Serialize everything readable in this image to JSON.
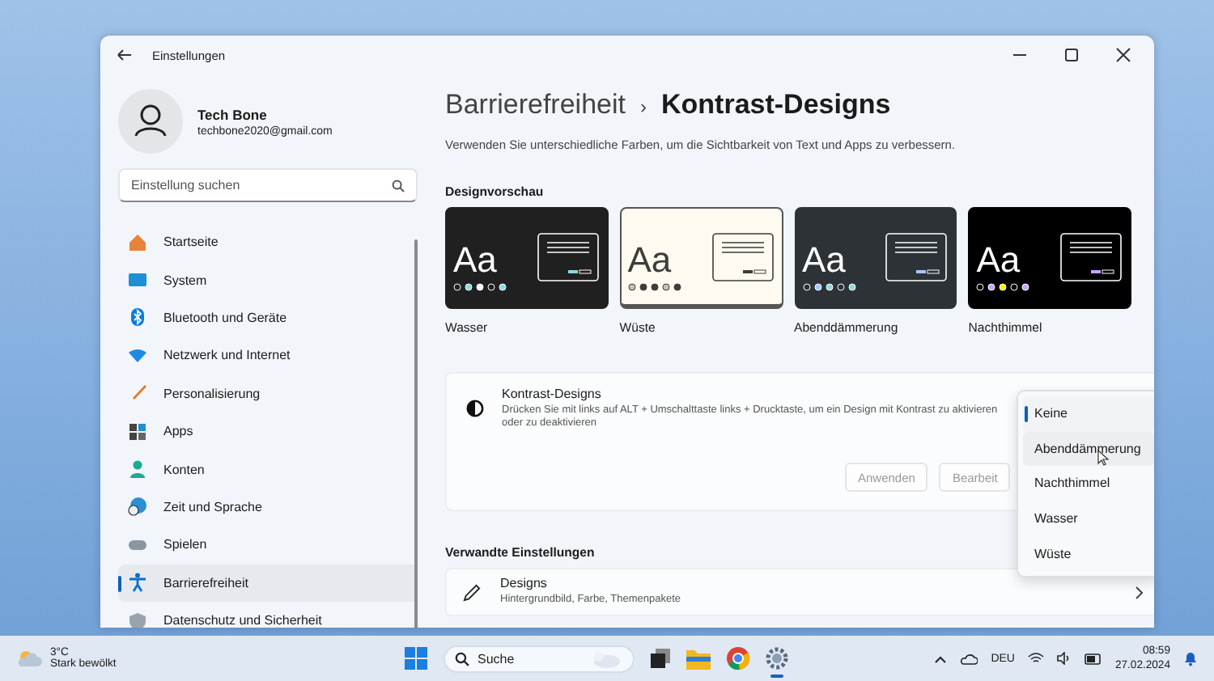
{
  "window": {
    "title": "Einstellungen"
  },
  "profile": {
    "name": "Tech Bone",
    "email": "techbone2020@gmail.com"
  },
  "search": {
    "placeholder": "Einstellung suchen"
  },
  "sidebar": {
    "items": [
      {
        "label": "Startseite",
        "selected": false
      },
      {
        "label": "System",
        "selected": false
      },
      {
        "label": "Bluetooth und Geräte",
        "selected": false
      },
      {
        "label": "Netzwerk und Internet",
        "selected": false
      },
      {
        "label": "Personalisierung",
        "selected": false
      },
      {
        "label": "Apps",
        "selected": false
      },
      {
        "label": "Konten",
        "selected": false
      },
      {
        "label": "Zeit und Sprache",
        "selected": false
      },
      {
        "label": "Spielen",
        "selected": false
      },
      {
        "label": "Barrierefreiheit",
        "selected": true
      },
      {
        "label": "Datenschutz und Sicherheit",
        "selected": false
      }
    ]
  },
  "breadcrumb": {
    "parent": "Barrierefreiheit",
    "separator": "›",
    "current": "Kontrast-Designs"
  },
  "description": "Verwenden Sie unterschiedliche Farben, um die Sichtbarkeit von Text und Apps zu verbessern.",
  "preview": {
    "heading": "Designvorschau",
    "themes": [
      {
        "name": "Wasser",
        "sample": "Aa",
        "color": "#202020"
      },
      {
        "name": "Wüste",
        "sample": "Aa",
        "color": "#fffaef"
      },
      {
        "name": "Abenddämmerung",
        "sample": "Aa",
        "color": "#2d3236"
      },
      {
        "name": "Nachthimmel",
        "sample": "Aa",
        "color": "#000000"
      }
    ]
  },
  "contrast_card": {
    "title": "Kontrast-Designs",
    "hint": "Drücken Sie mit links auf ALT + Umschalttaste links + Drucktaste, um ein Design mit Kontrast zu aktivieren oder zu deaktivieren",
    "buttons": [
      {
        "label": "Anwenden",
        "disabled": true
      },
      {
        "label": "Bearbeit",
        "disabled": true
      }
    ]
  },
  "dropdown": {
    "items": [
      {
        "label": "Keine",
        "selected": true,
        "hovered": false
      },
      {
        "label": "Abenddämmerung",
        "selected": false,
        "hovered": true
      },
      {
        "label": "Nachthimmel",
        "selected": false,
        "hovered": false
      },
      {
        "label": "Wasser",
        "selected": false,
        "hovered": false
      },
      {
        "label": "Wüste",
        "selected": false,
        "hovered": false
      }
    ]
  },
  "related": {
    "heading": "Verwandte Einstellungen",
    "items": [
      {
        "title": "Designs",
        "subtitle": "Hintergrundbild, Farbe, Themenpakete"
      }
    ]
  },
  "taskbar": {
    "weather": {
      "temp": "3°C",
      "condition": "Stark bewölkt"
    },
    "search": {
      "placeholder": "Suche"
    },
    "language": "DEU",
    "time": "08:59",
    "date": "27.02.2024"
  }
}
